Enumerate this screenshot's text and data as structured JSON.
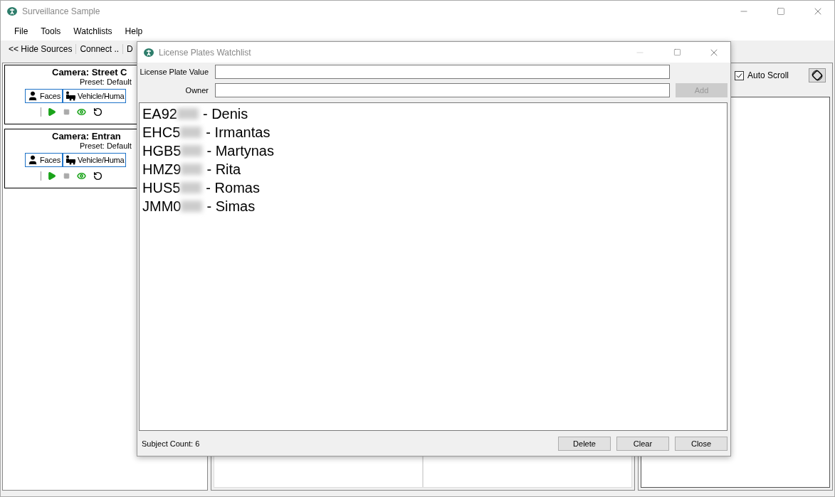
{
  "window": {
    "title": "Surveillance Sample"
  },
  "menu": [
    "File",
    "Tools",
    "Watchlists",
    "Help"
  ],
  "toolbar": [
    "<< Hide Sources",
    "Connect ..",
    "D"
  ],
  "cameras": [
    {
      "title": "Camera: Street C",
      "preset": "Preset: Default",
      "tabs": [
        {
          "label": "Faces",
          "kind": "face"
        },
        {
          "label": "Vehicle/Huma",
          "kind": "vehicle"
        }
      ]
    },
    {
      "title": "Camera: Entran",
      "preset": "Preset: Default",
      "tabs": [
        {
          "label": "Faces",
          "kind": "face"
        },
        {
          "label": "Vehicle/Huma",
          "kind": "vehicle"
        }
      ]
    }
  ],
  "right_panel": {
    "auto_scroll": {
      "label": "Auto Scroll",
      "checked": true
    }
  },
  "dialog": {
    "title": "License Plates Watchlist",
    "fields": [
      {
        "label": "License Plate Value"
      },
      {
        "label": "Owner"
      }
    ],
    "add_button": {
      "label": "Add",
      "disabled": true
    },
    "entries": [
      {
        "plate": "EA92",
        "owner": "- Denis"
      },
      {
        "plate": "EHC5",
        "owner": "- Irmantas"
      },
      {
        "plate": "HGB5",
        "owner": "- Martynas"
      },
      {
        "plate": "HMZ9",
        "owner": "- Rita"
      },
      {
        "plate": "HUS5",
        "owner": "- Romas"
      },
      {
        "plate": "JMM0",
        "owner": "- Simas"
      }
    ],
    "subject_count": "Subject Count: 6",
    "buttons": [
      "Delete",
      "Clear",
      "Close"
    ]
  }
}
